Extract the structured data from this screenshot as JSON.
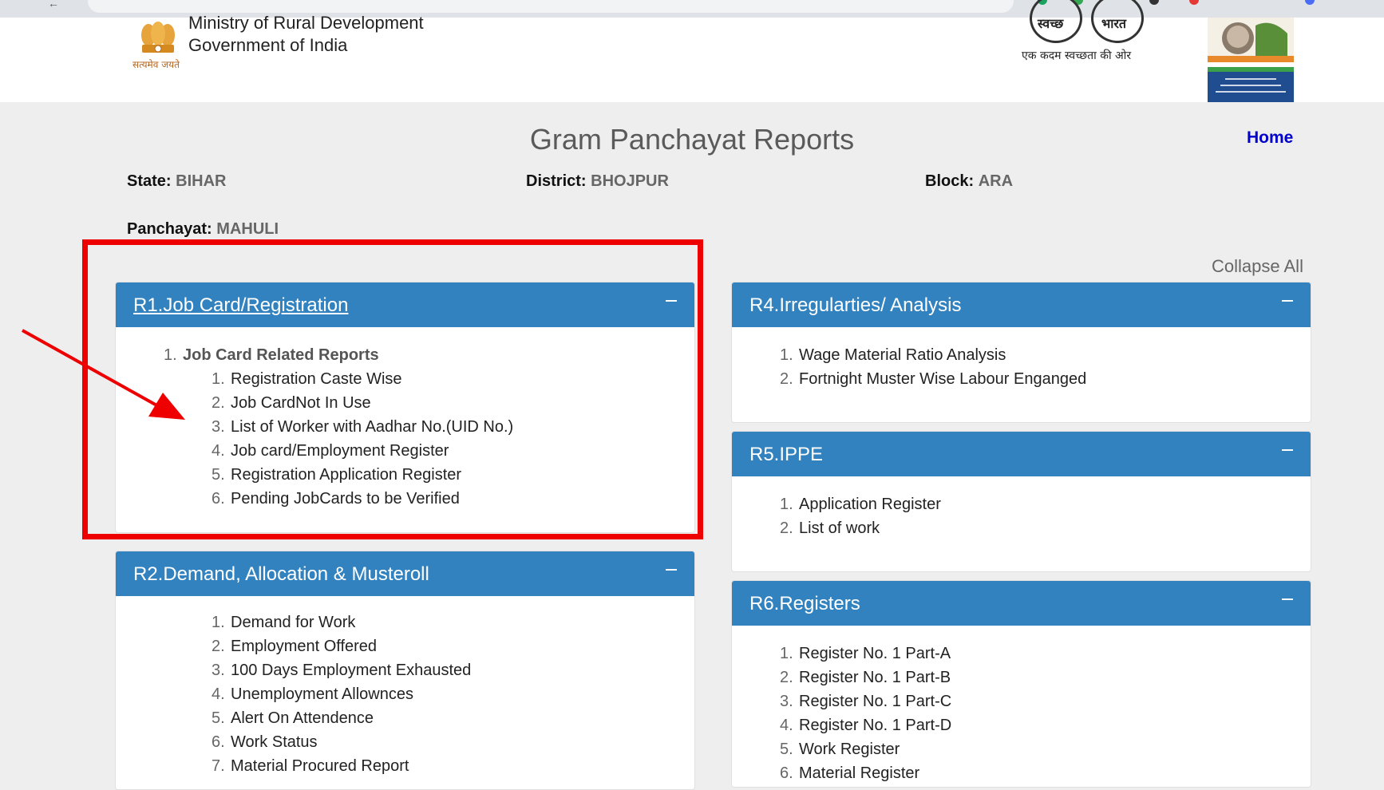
{
  "header": {
    "ministry_line1": "Ministry of Rural Development",
    "ministry_line2": "Government of India",
    "emblem_motto": "सत्यमेव जयते",
    "swachh_word1": "स्वच्छ",
    "swachh_word2": "भारत",
    "swachh_tagline": "एक कदम स्वच्छता की ओर"
  },
  "page": {
    "title": "Gram Panchayat Reports",
    "home_label": "Home",
    "collapse_all": "Collapse All"
  },
  "info": {
    "state_label": "State:",
    "state_value": "BIHAR",
    "district_label": "District:",
    "district_value": "BHOJPUR",
    "block_label": "Block:",
    "block_value": "ARA",
    "panchayat_label": "Panchayat:",
    "panchayat_value": "MAHULI"
  },
  "panels": {
    "r1": {
      "title": "R1.Job Card/Registration",
      "group": "Job Card Related Reports",
      "items": [
        "Registration Caste Wise",
        "Job CardNot In Use",
        "List of Worker with Aadhar No.(UID No.)",
        "Job card/Employment Register",
        "Registration Application Register",
        "Pending JobCards to be Verified"
      ]
    },
    "r2": {
      "title": "R2.Demand, Allocation & Musteroll",
      "items": [
        "Demand for Work",
        "Employment Offered",
        "100 Days Employment Exhausted",
        "Unemployment Allownces",
        "Alert On Attendence",
        "Work Status",
        "Material Procured Report"
      ]
    },
    "r4": {
      "title": "R4.Irregularties/ Analysis",
      "items": [
        "Wage Material Ratio Analysis",
        "Fortnight Muster Wise Labour Enganged"
      ]
    },
    "r5": {
      "title": "R5.IPPE",
      "items": [
        "Application Register",
        "List of work"
      ]
    },
    "r6": {
      "title": "R6.Registers",
      "items": [
        "Register No. 1 Part-A",
        "Register No. 1 Part-B",
        "Register No. 1 Part-C",
        "Register No. 1 Part-D",
        "Work Register",
        "Material Register"
      ]
    }
  },
  "colors": {
    "panel_header": "#3182be",
    "annotation_red": "#ee0000",
    "home_link": "#0000cc"
  }
}
